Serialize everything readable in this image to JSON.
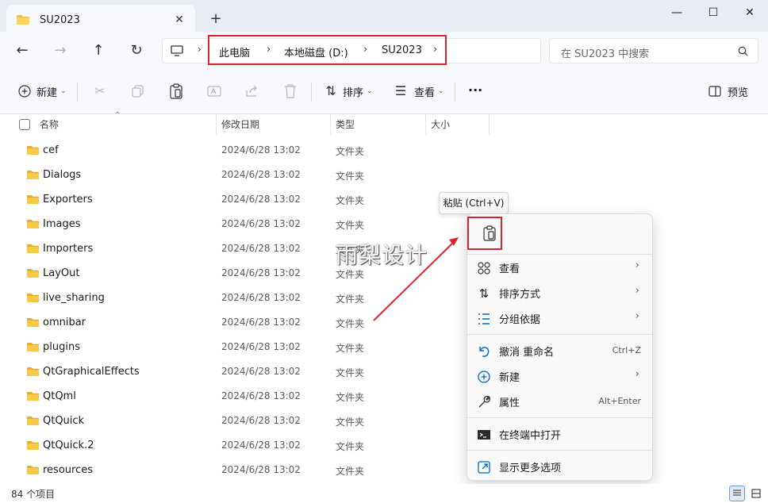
{
  "window": {
    "tab_title": "SU2023",
    "tab_close": "✕",
    "new_tab": "+",
    "minimize": "—",
    "maximize": "☐",
    "close": "✕"
  },
  "address": {
    "crumbs": [
      "此电脑",
      "本地磁盘 (D:)",
      "SU2023"
    ],
    "search_placeholder": "在 SU2023 中搜索"
  },
  "toolbar": {
    "new_label": "新建",
    "sort_label": "排序",
    "view_label": "查看",
    "more_label": "···",
    "preview_label": "预览"
  },
  "columns": {
    "name": "名称",
    "date": "修改日期",
    "type": "类型",
    "size": "大小"
  },
  "files": [
    {
      "name": "cef",
      "date": "2024/6/28 13:02",
      "type": "文件夹"
    },
    {
      "name": "Dialogs",
      "date": "2024/6/28 13:02",
      "type": "文件夹"
    },
    {
      "name": "Exporters",
      "date": "2024/6/28 13:02",
      "type": "文件夹"
    },
    {
      "name": "Images",
      "date": "2024/6/28 13:02",
      "type": "文件夹"
    },
    {
      "name": "Importers",
      "date": "2024/6/28 13:02",
      "type": "文件夹"
    },
    {
      "name": "LayOut",
      "date": "2024/6/28 13:02",
      "type": "文件夹"
    },
    {
      "name": "live_sharing",
      "date": "2024/6/28 13:02",
      "type": "文件夹"
    },
    {
      "name": "omnibar",
      "date": "2024/6/28 13:02",
      "type": "文件夹"
    },
    {
      "name": "plugins",
      "date": "2024/6/28 13:02",
      "type": "文件夹"
    },
    {
      "name": "QtGraphicalEffects",
      "date": "2024/6/28 13:02",
      "type": "文件夹"
    },
    {
      "name": "QtQml",
      "date": "2024/6/28 13:02",
      "type": "文件夹"
    },
    {
      "name": "QtQuick",
      "date": "2024/6/28 13:02",
      "type": "文件夹"
    },
    {
      "name": "QtQuick.2",
      "date": "2024/6/28 13:02",
      "type": "文件夹"
    },
    {
      "name": "resources",
      "date": "2024/6/28 13:02",
      "type": "文件夹"
    }
  ],
  "status": {
    "count": "84 个项目"
  },
  "tooltip": "粘贴 (Ctrl+V)",
  "context_menu": {
    "view": "查看",
    "sort_by": "排序方式",
    "group_by": "分组依据",
    "undo": "撤消 重命名",
    "undo_shortcut": "Ctrl+Z",
    "new": "新建",
    "properties": "属性",
    "properties_shortcut": "Alt+Enter",
    "open_terminal": "在终端中打开",
    "more_options": "显示更多选项",
    "submenu_arrow": "›"
  },
  "watermark": "雨梨设计",
  "colors": {
    "highlight_red": "#d7262f",
    "folder_yellow": "#f5c342",
    "accent_blue": "#0067c0"
  }
}
